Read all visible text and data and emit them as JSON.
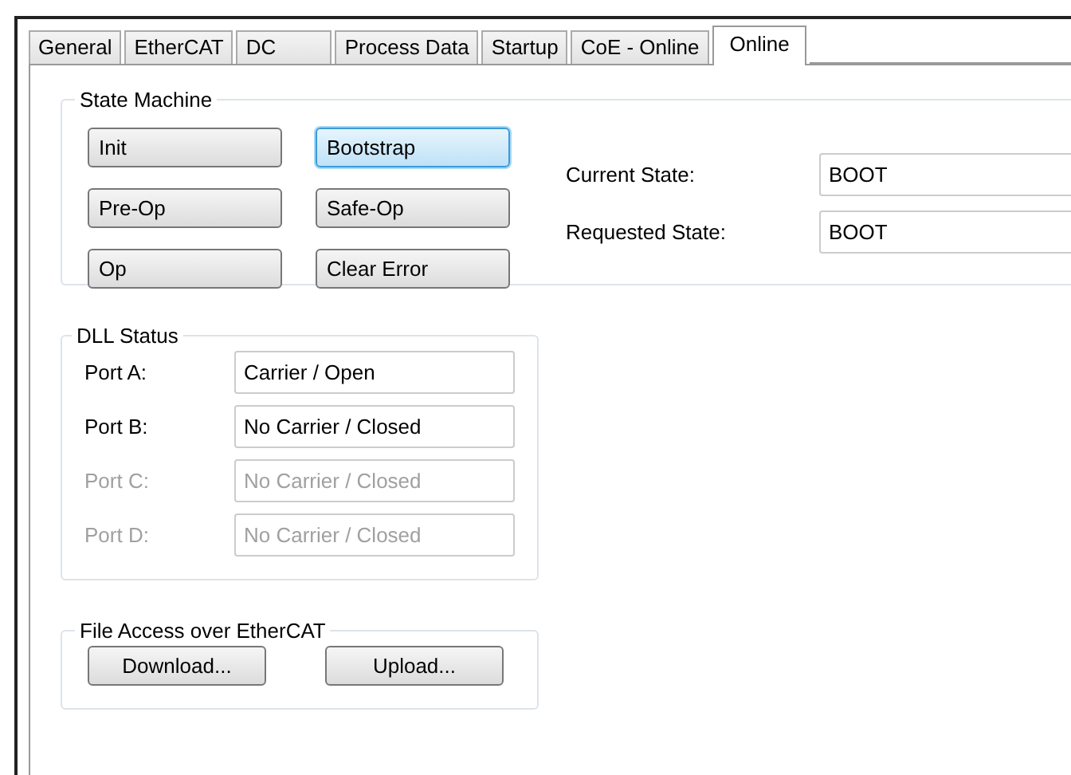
{
  "tabs": [
    {
      "label": "General",
      "selected": false
    },
    {
      "label": "EtherCAT",
      "selected": false
    },
    {
      "label": "DC",
      "selected": false
    },
    {
      "label": "Process Data",
      "selected": false
    },
    {
      "label": "Startup",
      "selected": false
    },
    {
      "label": "CoE - Online",
      "selected": false
    },
    {
      "label": "Online",
      "selected": true
    }
  ],
  "state_machine": {
    "title": "State Machine",
    "buttons": [
      {
        "label": "Init",
        "focused": false
      },
      {
        "label": "Bootstrap",
        "focused": true
      },
      {
        "label": "Pre-Op",
        "focused": false
      },
      {
        "label": "Safe-Op",
        "focused": false
      },
      {
        "label": "Op",
        "focused": false
      },
      {
        "label": "Clear Error",
        "focused": false
      }
    ],
    "fields": [
      {
        "label": "Current State:",
        "value": "BOOT"
      },
      {
        "label": "Requested State:",
        "value": "BOOT"
      }
    ]
  },
  "dll_status": {
    "title": "DLL Status",
    "ports": [
      {
        "label": "Port A:",
        "value": "Carrier / Open",
        "disabled": false
      },
      {
        "label": "Port B:",
        "value": "No Carrier / Closed",
        "disabled": false
      },
      {
        "label": "Port C:",
        "value": "No Carrier / Closed",
        "disabled": true
      },
      {
        "label": "Port D:",
        "value": "No Carrier / Closed",
        "disabled": true
      }
    ]
  },
  "file_access": {
    "title": "File Access over EtherCAT",
    "buttons": [
      "Download...",
      "Upload..."
    ]
  }
}
